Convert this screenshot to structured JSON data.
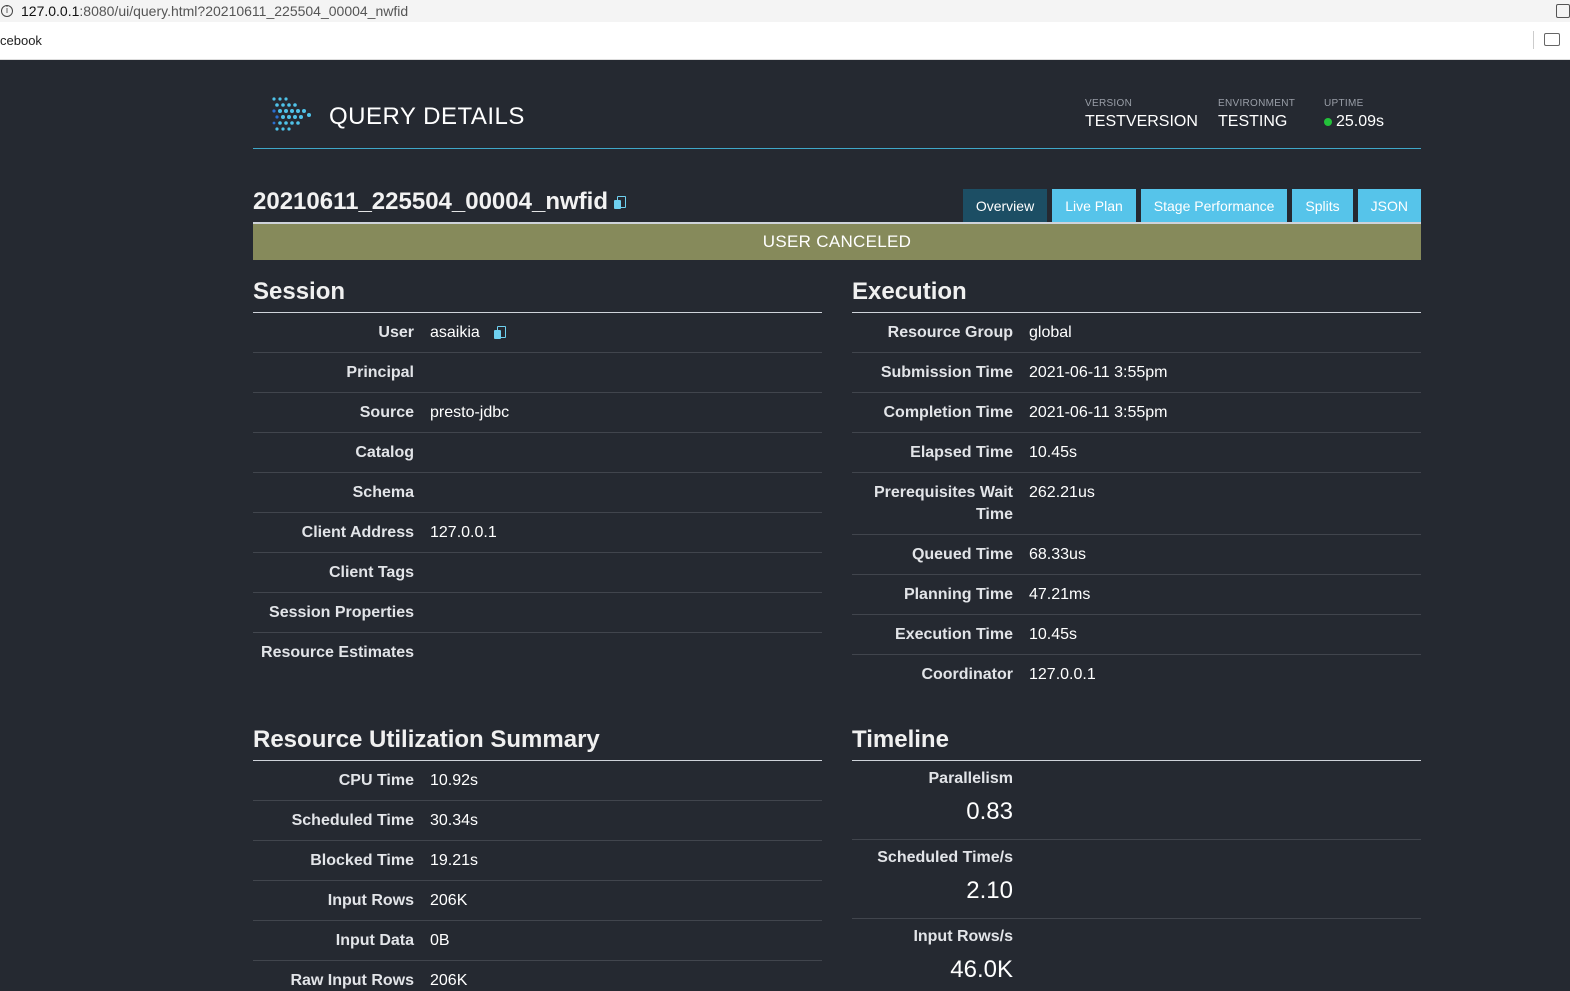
{
  "browser": {
    "url_host": "127.0.0.1",
    "url_rest": ":8080/ui/query.html?20210611_225504_00004_nwfid",
    "bookmark_label": "cebook"
  },
  "header": {
    "title": "QUERY DETAILS",
    "version_label": "VERSION",
    "version_value": "TESTVERSION",
    "environment_label": "ENVIRONMENT",
    "environment_value": "TESTING",
    "uptime_label": "UPTIME",
    "uptime_value": "25.09s"
  },
  "query": {
    "id": "20210611_225504_00004_nwfid",
    "state": "USER CANCELED"
  },
  "tabs": [
    {
      "label": "Overview",
      "active": true
    },
    {
      "label": "Live Plan"
    },
    {
      "label": "Stage Performance"
    },
    {
      "label": "Splits"
    },
    {
      "label": "JSON"
    }
  ],
  "session": {
    "title": "Session",
    "rows": [
      {
        "label": "User",
        "value": "asaikia"
      },
      {
        "label": "Principal",
        "value": ""
      },
      {
        "label": "Source",
        "value": "presto-jdbc"
      },
      {
        "label": "Catalog",
        "value": ""
      },
      {
        "label": "Schema",
        "value": ""
      },
      {
        "label": "Client Address",
        "value": "127.0.0.1"
      },
      {
        "label": "Client Tags",
        "value": ""
      },
      {
        "label": "Session Properties",
        "value": ""
      },
      {
        "label": "Resource Estimates",
        "value": ""
      }
    ]
  },
  "execution": {
    "title": "Execution",
    "rows": [
      {
        "label": "Resource Group",
        "value": "global"
      },
      {
        "label": "Submission Time",
        "value": "2021-06-11 3:55pm"
      },
      {
        "label": "Completion Time",
        "value": "2021-06-11 3:55pm"
      },
      {
        "label": "Elapsed Time",
        "value": "10.45s"
      },
      {
        "label": "Prerequisites Wait Time",
        "value": "262.21us"
      },
      {
        "label": "Queued Time",
        "value": "68.33us"
      },
      {
        "label": "Planning Time",
        "value": "47.21ms"
      },
      {
        "label": "Execution Time",
        "value": "10.45s"
      },
      {
        "label": "Coordinator",
        "value": "127.0.0.1"
      }
    ]
  },
  "resource_summary": {
    "title": "Resource Utilization Summary",
    "rows": [
      {
        "label": "CPU Time",
        "value": "10.92s"
      },
      {
        "label": "Scheduled Time",
        "value": "30.34s"
      },
      {
        "label": "Blocked Time",
        "value": "19.21s"
      },
      {
        "label": "Input Rows",
        "value": "206K"
      },
      {
        "label": "Input Data",
        "value": "0B"
      },
      {
        "label": "Raw Input Rows",
        "value": "206K"
      }
    ]
  },
  "timeline": {
    "title": "Timeline",
    "rows": [
      {
        "label": "Parallelism",
        "value": "0.83"
      },
      {
        "label": "Scheduled Time/s",
        "value": "2.10"
      },
      {
        "label": "Input Rows/s",
        "value": "46.0K"
      }
    ]
  },
  "colors": {
    "background": "#252931",
    "accent": "#56c4ea",
    "active_tab": "#1c4e64",
    "state_canceled": "#868a5b",
    "uptime_dot": "#23c13a"
  }
}
